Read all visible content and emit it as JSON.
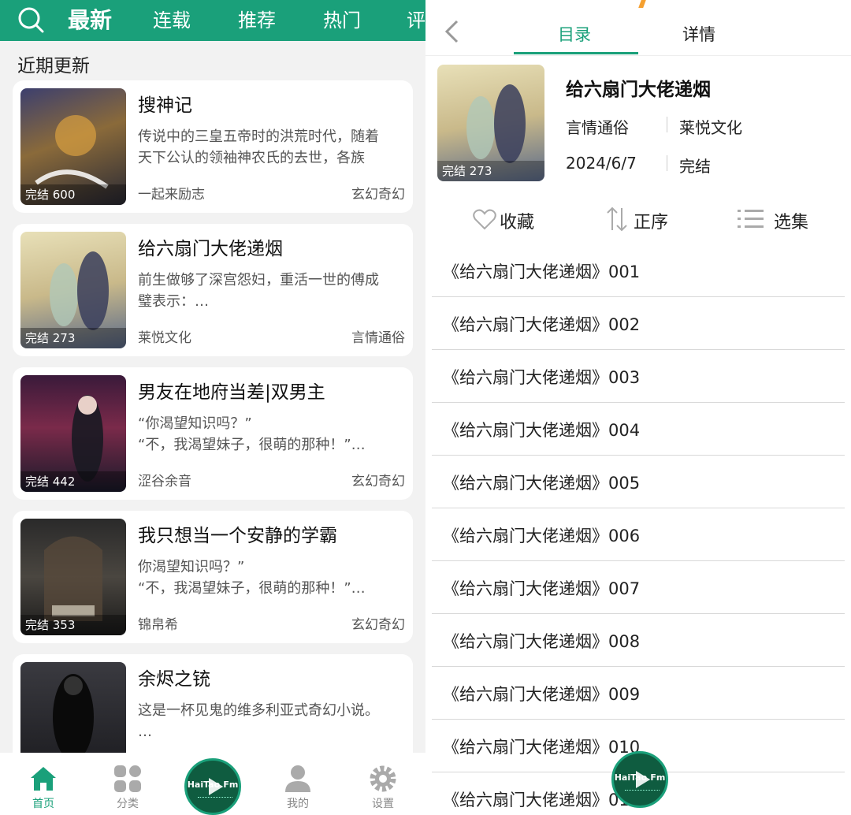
{
  "left": {
    "nav": [
      "最新",
      "连载",
      "推荐",
      "热门",
      "评"
    ],
    "section_title": "近期更新",
    "books": [
      {
        "title": "搜神记",
        "desc": "传说中的三皇五帝时的洪荒时代，随着\n天下公认的领袖神农氏的去世，各族",
        "author": "一起来励志",
        "genre": "玄幻奇幻",
        "badge": "完结 600"
      },
      {
        "title": "给六扇门大佬递烟",
        "desc": "前生做够了深宫怨妇，重活一世的傅成\n璧表示：…",
        "author": "莱悦文化",
        "genre": "言情通俗",
        "badge": "完结 273"
      },
      {
        "title": "男友在地府当差|双男主",
        "desc": "“你渴望知识吗？”\n“不，我渴望妹子，很萌的那种！”…",
        "author": "涩谷余音",
        "genre": "玄幻奇幻",
        "badge": "完结 442"
      },
      {
        "title": "我只想当一个安静的学霸",
        "desc": "你渴望知识吗？”\n“不，我渴望妹子，很萌的那种！”…",
        "author": "锦帛希",
        "genre": "玄幻奇幻",
        "badge": "完结 353"
      },
      {
        "title": "余烬之铳",
        "desc": "这是一杯见鬼的维多利亚式奇幻小说。\n…",
        "author": "",
        "genre": "",
        "badge": ""
      }
    ],
    "bottom_tabs": {
      "home": "首页",
      "category": "分类",
      "mine": "我的",
      "settings": "设置"
    },
    "player_brand": "HaiTao.Fm"
  },
  "right": {
    "tabs": [
      "目录",
      "详情"
    ],
    "book": {
      "title": "给六扇门大佬递烟",
      "badge": "完结 273",
      "genre": "言情通俗",
      "publisher": "莱悦文化",
      "date": "2024/6/7",
      "status": "完结"
    },
    "actions": {
      "favorite": "收藏",
      "order": "正序",
      "select": "选集"
    },
    "chapters": [
      "《给六扇门大佬递烟》001",
      "《给六扇门大佬递烟》002",
      "《给六扇门大佬递烟》003",
      "《给六扇门大佬递烟》004",
      "《给六扇门大佬递烟》005",
      "《给六扇门大佬递烟》006",
      "《给六扇门大佬递烟》007",
      "《给六扇门大佬递烟》008",
      "《给六扇门大佬递烟》009",
      "《给六扇门大佬递烟》010",
      "《给六扇门大佬递烟》011"
    ],
    "player_brand": "HaiTao.Fm"
  },
  "colors": {
    "accent": "#1aa07a",
    "background": "#f2f2f2"
  }
}
